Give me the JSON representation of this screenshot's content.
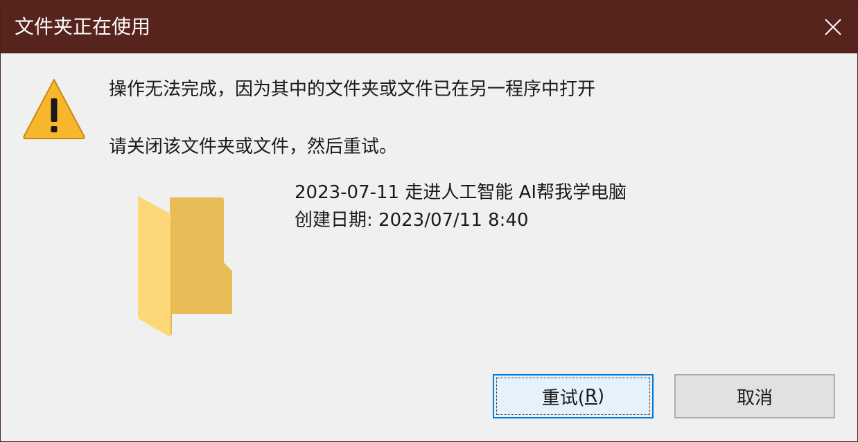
{
  "window": {
    "title": "文件夹正在使用"
  },
  "icons": {
    "warning": "warning-triangle-icon",
    "folder": "folder-icon",
    "close": "close-icon"
  },
  "message": {
    "line1": "操作无法完成，因为其中的文件夹或文件已在另一程序中打开",
    "line2": "请关闭该文件夹或文件，然后重试。"
  },
  "file": {
    "name": "2023-07-11 走进人工智能  AI帮我学电脑",
    "created": "创建日期: 2023/07/11 8:40"
  },
  "buttons": {
    "retry": {
      "label_prefix": "重试(",
      "mnemonic": "R",
      "label_suffix": ")"
    },
    "cancel": {
      "label": "取消"
    }
  },
  "colors": {
    "titlebar": "#56241c",
    "dialog_bg": "#f0f0f0",
    "focus_border": "#0078d7",
    "warning_fill": "#f7b62c",
    "folder_fill": "#fcd878"
  }
}
